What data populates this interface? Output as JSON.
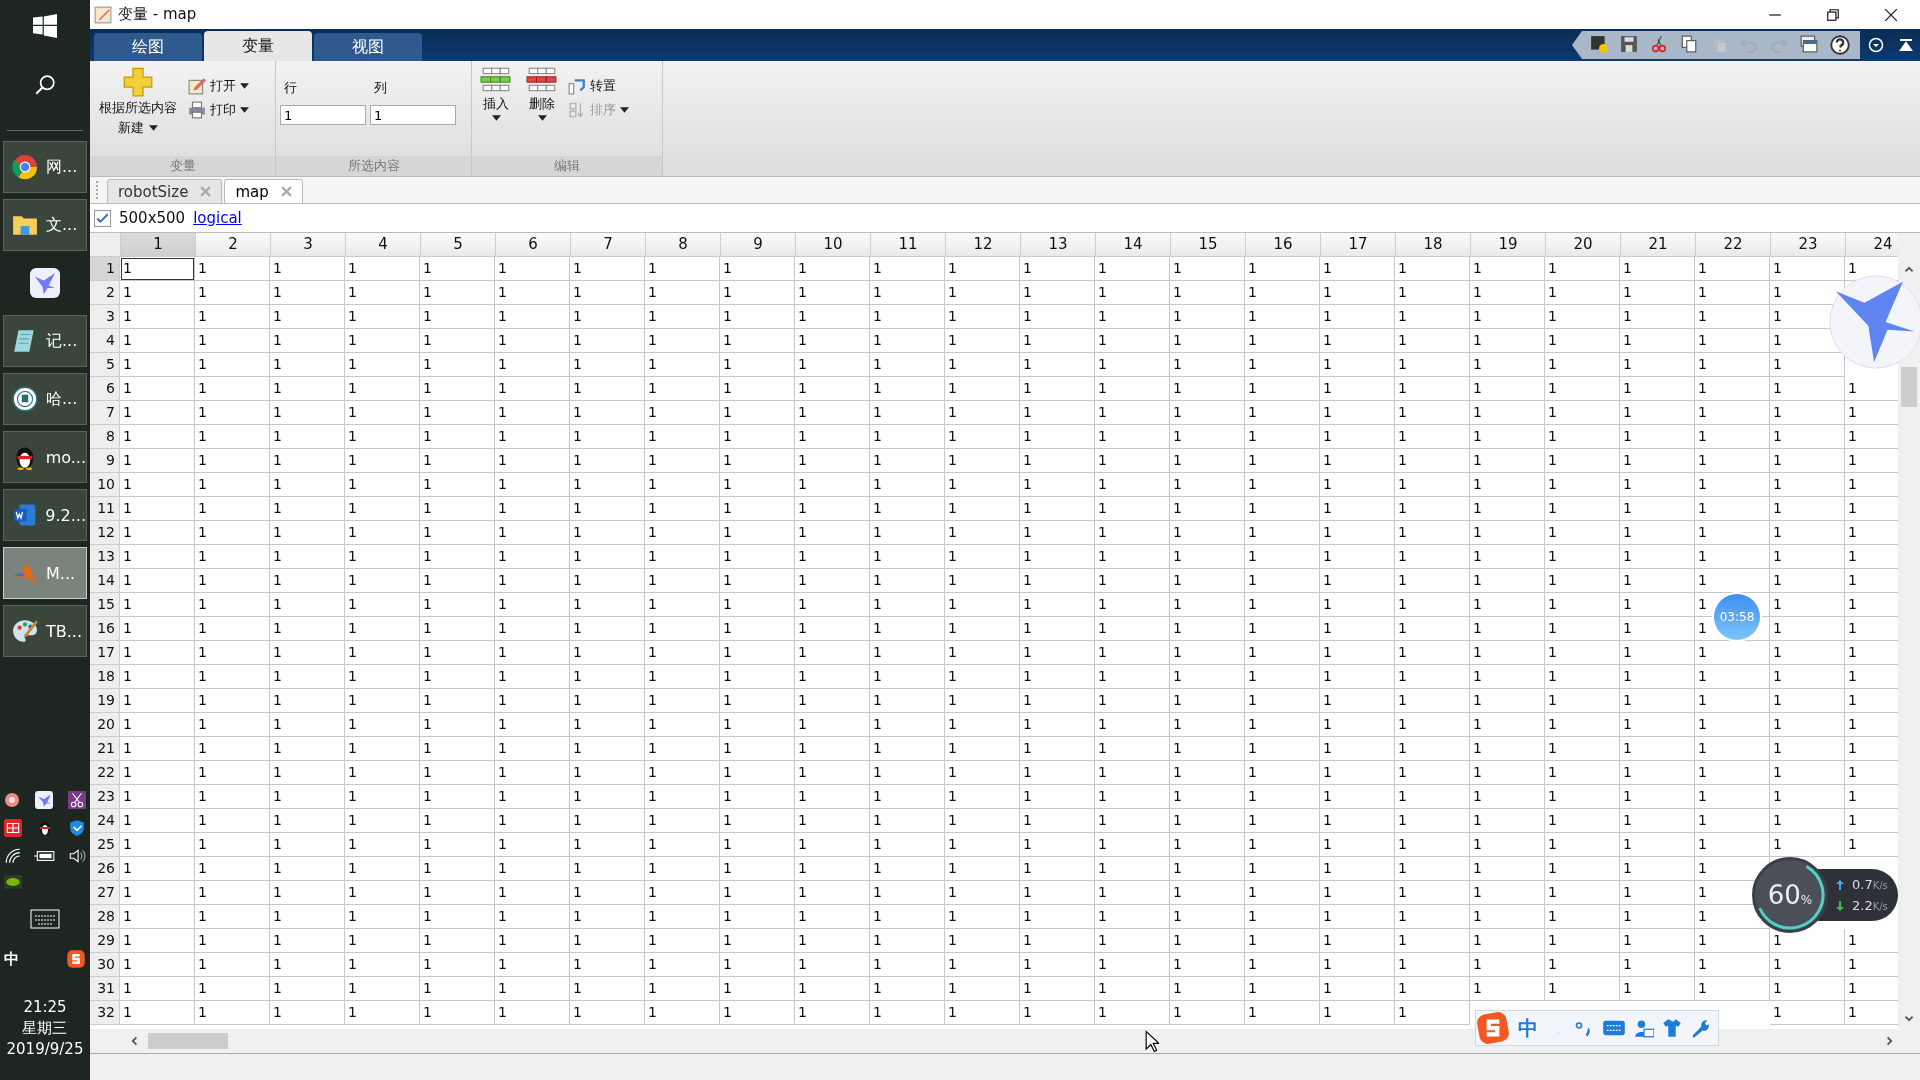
{
  "taskbar": {
    "apps": [
      {
        "kind": "ring",
        "label": "网...",
        "selected": false
      },
      {
        "kind": "folder",
        "label": "文...",
        "selected": false
      },
      {
        "kind": "bird"
      },
      {
        "kind": "notepad",
        "label": "记...",
        "selected": false
      },
      {
        "kind": "emblem",
        "label": "哈...",
        "selected": false
      },
      {
        "kind": "penguin",
        "label": "mo...",
        "selected": false
      },
      {
        "kind": "document",
        "label": "9.2...",
        "selected": false
      },
      {
        "kind": "peak",
        "label": "M...",
        "selected": true
      },
      {
        "kind": "palette",
        "label": "TB...",
        "selected": false
      }
    ],
    "ime": "中",
    "clock": {
      "time": "21:25",
      "weekday": "星期三",
      "date": "2019/9/25"
    }
  },
  "window": {
    "title": "变量 - map"
  },
  "ribbon_tabs": [
    {
      "label": "绘图",
      "selected": false
    },
    {
      "label": "变量",
      "selected": true
    },
    {
      "label": "视图",
      "selected": false
    }
  ],
  "ribbon": {
    "variable_group": {
      "title": "变量",
      "new_label": "根据所选内容",
      "new_label_2": "新建",
      "open": "打开",
      "print": "打印"
    },
    "selection_group": {
      "title": "所选内容",
      "row_label": "行",
      "col_label": "列",
      "row_value": "1",
      "col_value": "1"
    },
    "edit_group": {
      "title": "编辑",
      "insert": "插入",
      "delete": "删除",
      "transpose": "转置",
      "sort": "排序",
      "sort_disabled": true
    }
  },
  "doc_tabs": [
    {
      "label": "robotSize",
      "selected": false
    },
    {
      "label": "map",
      "selected": true
    }
  ],
  "info": {
    "checked": true,
    "size": "500x500",
    "class_link": "logical"
  },
  "table": {
    "columns": [
      {
        "label": "1",
        "selected": true
      },
      {
        "label": "2",
        "selected": false
      },
      {
        "label": "3",
        "selected": false
      },
      {
        "label": "4",
        "selected": false
      },
      {
        "label": "5",
        "selected": false
      },
      {
        "label": "6",
        "selected": false
      },
      {
        "label": "7",
        "selected": false
      },
      {
        "label": "8",
        "selected": false
      },
      {
        "label": "9",
        "selected": false
      },
      {
        "label": "10",
        "selected": false
      },
      {
        "label": "11",
        "selected": false
      },
      {
        "label": "12",
        "selected": false
      },
      {
        "label": "13",
        "selected": false
      },
      {
        "label": "14",
        "selected": false
      },
      {
        "label": "15",
        "selected": false
      },
      {
        "label": "16",
        "selected": false
      },
      {
        "label": "17",
        "selected": false
      },
      {
        "label": "18",
        "selected": false
      },
      {
        "label": "19",
        "selected": false
      },
      {
        "label": "20",
        "selected": false
      },
      {
        "label": "21",
        "selected": false
      },
      {
        "label": "22",
        "selected": false
      },
      {
        "label": "23",
        "selected": false
      },
      {
        "label": "24",
        "selected": false
      }
    ],
    "rows": [
      {
        "label": "1",
        "selected": true,
        "cells": [
          "1",
          "1",
          "1",
          "1",
          "1",
          "1",
          "1",
          "1",
          "1",
          "1",
          "1",
          "1",
          "1",
          "1",
          "1",
          "1",
          "1",
          "1",
          "1",
          "1",
          "1",
          "1",
          "1",
          "1"
        ]
      },
      {
        "label": "2",
        "selected": false,
        "cells": [
          "1",
          "1",
          "1",
          "1",
          "1",
          "1",
          "1",
          "1",
          "1",
          "1",
          "1",
          "1",
          "1",
          "1",
          "1",
          "1",
          "1",
          "1",
          "1",
          "1",
          "1",
          "1",
          "1",
          null
        ]
      },
      {
        "label": "3",
        "selected": false,
        "cells": [
          "1",
          "1",
          "1",
          "1",
          "1",
          "1",
          "1",
          "1",
          "1",
          "1",
          "1",
          "1",
          "1",
          "1",
          "1",
          "1",
          "1",
          "1",
          "1",
          "1",
          "1",
          "1",
          "1",
          null
        ]
      },
      {
        "label": "4",
        "selected": false,
        "cells": [
          "1",
          "1",
          "1",
          "1",
          "1",
          "1",
          "1",
          "1",
          "1",
          "1",
          "1",
          "1",
          "1",
          "1",
          "1",
          "1",
          "1",
          "1",
          "1",
          "1",
          "1",
          "1",
          "1",
          null
        ]
      },
      {
        "label": "5",
        "selected": false,
        "cells": [
          "1",
          "1",
          "1",
          "1",
          "1",
          "1",
          "1",
          "1",
          "1",
          "1",
          "1",
          "1",
          "1",
          "1",
          "1",
          "1",
          "1",
          "1",
          "1",
          "1",
          "1",
          "1",
          "1",
          null
        ]
      },
      {
        "label": "6",
        "selected": false,
        "cells": [
          "1",
          "1",
          "1",
          "1",
          "1",
          "1",
          "1",
          "1",
          "1",
          "1",
          "1",
          "1",
          "1",
          "1",
          "1",
          "1",
          "1",
          "1",
          "1",
          "1",
          "1",
          "1",
          "1",
          "1"
        ]
      },
      {
        "label": "7",
        "selected": false,
        "cells": [
          "1",
          "1",
          "1",
          "1",
          "1",
          "1",
          "1",
          "1",
          "1",
          "1",
          "1",
          "1",
          "1",
          "1",
          "1",
          "1",
          "1",
          "1",
          "1",
          "1",
          "1",
          "1",
          "1",
          "1"
        ]
      },
      {
        "label": "8",
        "selected": false,
        "cells": [
          "1",
          "1",
          "1",
          "1",
          "1",
          "1",
          "1",
          "1",
          "1",
          "1",
          "1",
          "1",
          "1",
          "1",
          "1",
          "1",
          "1",
          "1",
          "1",
          "1",
          "1",
          "1",
          "1",
          "1"
        ]
      },
      {
        "label": "9",
        "selected": false,
        "cells": [
          "1",
          "1",
          "1",
          "1",
          "1",
          "1",
          "1",
          "1",
          "1",
          "1",
          "1",
          "1",
          "1",
          "1",
          "1",
          "1",
          "1",
          "1",
          "1",
          "1",
          "1",
          "1",
          "1",
          "1"
        ]
      },
      {
        "label": "10",
        "selected": false,
        "cells": [
          "1",
          "1",
          "1",
          "1",
          "1",
          "1",
          "1",
          "1",
          "1",
          "1",
          "1",
          "1",
          "1",
          "1",
          "1",
          "1",
          "1",
          "1",
          "1",
          "1",
          "1",
          "1",
          "1",
          "1"
        ]
      },
      {
        "label": "11",
        "selected": false,
        "cells": [
          "1",
          "1",
          "1",
          "1",
          "1",
          "1",
          "1",
          "1",
          "1",
          "1",
          "1",
          "1",
          "1",
          "1",
          "1",
          "1",
          "1",
          "1",
          "1",
          "1",
          "1",
          "1",
          "1",
          "1"
        ]
      },
      {
        "label": "12",
        "selected": false,
        "cells": [
          "1",
          "1",
          "1",
          "1",
          "1",
          "1",
          "1",
          "1",
          "1",
          "1",
          "1",
          "1",
          "1",
          "1",
          "1",
          "1",
          "1",
          "1",
          "1",
          "1",
          "1",
          "1",
          "1",
          "1"
        ]
      },
      {
        "label": "13",
        "selected": false,
        "cells": [
          "1",
          "1",
          "1",
          "1",
          "1",
          "1",
          "1",
          "1",
          "1",
          "1",
          "1",
          "1",
          "1",
          "1",
          "1",
          "1",
          "1",
          "1",
          "1",
          "1",
          "1",
          "1",
          "1",
          "1"
        ]
      },
      {
        "label": "14",
        "selected": false,
        "cells": [
          "1",
          "1",
          "1",
          "1",
          "1",
          "1",
          "1",
          "1",
          "1",
          "1",
          "1",
          "1",
          "1",
          "1",
          "1",
          "1",
          "1",
          "1",
          "1",
          "1",
          "1",
          "1",
          "1",
          "1"
        ]
      },
      {
        "label": "15",
        "selected": false,
        "cells": [
          "1",
          "1",
          "1",
          "1",
          "1",
          "1",
          "1",
          "1",
          "1",
          "1",
          "1",
          "1",
          "1",
          "1",
          "1",
          "1",
          "1",
          "1",
          "1",
          "1",
          "1",
          "1",
          "1",
          "1"
        ]
      },
      {
        "label": "16",
        "selected": false,
        "cells": [
          "1",
          "1",
          "1",
          "1",
          "1",
          "1",
          "1",
          "1",
          "1",
          "1",
          "1",
          "1",
          "1",
          "1",
          "1",
          "1",
          "1",
          "1",
          "1",
          "1",
          "1",
          "1",
          "1",
          "1"
        ]
      },
      {
        "label": "17",
        "selected": false,
        "cells": [
          "1",
          "1",
          "1",
          "1",
          "1",
          "1",
          "1",
          "1",
          "1",
          "1",
          "1",
          "1",
          "1",
          "1",
          "1",
          "1",
          "1",
          "1",
          "1",
          "1",
          "1",
          "1",
          "1",
          "1"
        ]
      },
      {
        "label": "18",
        "selected": false,
        "cells": [
          "1",
          "1",
          "1",
          "1",
          "1",
          "1",
          "1",
          "1",
          "1",
          "1",
          "1",
          "1",
          "1",
          "1",
          "1",
          "1",
          "1",
          "1",
          "1",
          "1",
          "1",
          "1",
          "1",
          "1"
        ]
      },
      {
        "label": "19",
        "selected": false,
        "cells": [
          "1",
          "1",
          "1",
          "1",
          "1",
          "1",
          "1",
          "1",
          "1",
          "1",
          "1",
          "1",
          "1",
          "1",
          "1",
          "1",
          "1",
          "1",
          "1",
          "1",
          "1",
          "1",
          "1",
          "1"
        ]
      },
      {
        "label": "20",
        "selected": false,
        "cells": [
          "1",
          "1",
          "1",
          "1",
          "1",
          "1",
          "1",
          "1",
          "1",
          "1",
          "1",
          "1",
          "1",
          "1",
          "1",
          "1",
          "1",
          "1",
          "1",
          "1",
          "1",
          "1",
          "1",
          "1"
        ]
      },
      {
        "label": "21",
        "selected": false,
        "cells": [
          "1",
          "1",
          "1",
          "1",
          "1",
          "1",
          "1",
          "1",
          "1",
          "1",
          "1",
          "1",
          "1",
          "1",
          "1",
          "1",
          "1",
          "1",
          "1",
          "1",
          "1",
          "1",
          "1",
          "1"
        ]
      },
      {
        "label": "22",
        "selected": false,
        "cells": [
          "1",
          "1",
          "1",
          "1",
          "1",
          "1",
          "1",
          "1",
          "1",
          "1",
          "1",
          "1",
          "1",
          "1",
          "1",
          "1",
          "1",
          "1",
          "1",
          "1",
          "1",
          "1",
          "1",
          "1"
        ]
      },
      {
        "label": "23",
        "selected": false,
        "cells": [
          "1",
          "1",
          "1",
          "1",
          "1",
          "1",
          "1",
          "1",
          "1",
          "1",
          "1",
          "1",
          "1",
          "1",
          "1",
          "1",
          "1",
          "1",
          "1",
          "1",
          "1",
          "1",
          "1",
          "1"
        ]
      },
      {
        "label": "24",
        "selected": false,
        "cells": [
          "1",
          "1",
          "1",
          "1",
          "1",
          "1",
          "1",
          "1",
          "1",
          "1",
          "1",
          "1",
          "1",
          "1",
          "1",
          "1",
          "1",
          "1",
          "1",
          "1",
          "1",
          "1",
          "1",
          "1"
        ]
      },
      {
        "label": "25",
        "selected": false,
        "cells": [
          "1",
          "1",
          "1",
          "1",
          "1",
          "1",
          "1",
          "1",
          "1",
          "1",
          "1",
          "1",
          "1",
          "1",
          "1",
          "1",
          "1",
          "1",
          "1",
          "1",
          "1",
          "1",
          "1",
          "1"
        ]
      },
      {
        "label": "26",
        "selected": false,
        "cells": [
          "1",
          "1",
          "1",
          "1",
          "1",
          "1",
          "1",
          "1",
          "1",
          "1",
          "1",
          "1",
          "1",
          "1",
          "1",
          "1",
          "1",
          "1",
          "1",
          "1",
          "1",
          "1",
          null,
          null
        ]
      },
      {
        "label": "27",
        "selected": false,
        "cells": [
          "1",
          "1",
          "1",
          "1",
          "1",
          "1",
          "1",
          "1",
          "1",
          "1",
          "1",
          "1",
          "1",
          "1",
          "1",
          "1",
          "1",
          "1",
          "1",
          "1",
          "1",
          "1",
          null,
          null
        ]
      },
      {
        "label": "28",
        "selected": false,
        "cells": [
          "1",
          "1",
          "1",
          "1",
          "1",
          "1",
          "1",
          "1",
          "1",
          "1",
          "1",
          "1",
          "1",
          "1",
          "1",
          "1",
          "1",
          "1",
          "1",
          "1",
          "1",
          "1",
          null,
          null
        ]
      },
      {
        "label": "29",
        "selected": false,
        "cells": [
          "1",
          "1",
          "1",
          "1",
          "1",
          "1",
          "1",
          "1",
          "1",
          "1",
          "1",
          "1",
          "1",
          "1",
          "1",
          "1",
          "1",
          "1",
          "1",
          "1",
          "1",
          "1",
          "1",
          "1"
        ]
      },
      {
        "label": "30",
        "selected": false,
        "cells": [
          "1",
          "1",
          "1",
          "1",
          "1",
          "1",
          "1",
          "1",
          "1",
          "1",
          "1",
          "1",
          "1",
          "1",
          "1",
          "1",
          "1",
          "1",
          "1",
          "1",
          "1",
          "1",
          "1",
          "1"
        ]
      },
      {
        "label": "31",
        "selected": false,
        "cells": [
          "1",
          "1",
          "1",
          "1",
          "1",
          "1",
          "1",
          "1",
          "1",
          "1",
          "1",
          "1",
          "1",
          "1",
          "1",
          "1",
          "1",
          "1",
          "1",
          "1",
          "1",
          "1",
          "1",
          "1"
        ]
      },
      {
        "label": "32",
        "selected": false,
        "cells": [
          "1",
          "1",
          "1",
          "1",
          "1",
          "1",
          "1",
          "1",
          "1",
          "1",
          "1",
          "1",
          "1",
          "1",
          "1",
          "1",
          "1",
          "1",
          null,
          null,
          null,
          null,
          "1",
          "1"
        ]
      }
    ]
  },
  "overlays": {
    "timer": "03:58",
    "meter": {
      "percent": "60",
      "unit": "%",
      "up": "0.7",
      "up_unit": "K/s",
      "down": "2.2",
      "down_unit": "K/s"
    },
    "ime_bar": {
      "label": "中"
    }
  }
}
